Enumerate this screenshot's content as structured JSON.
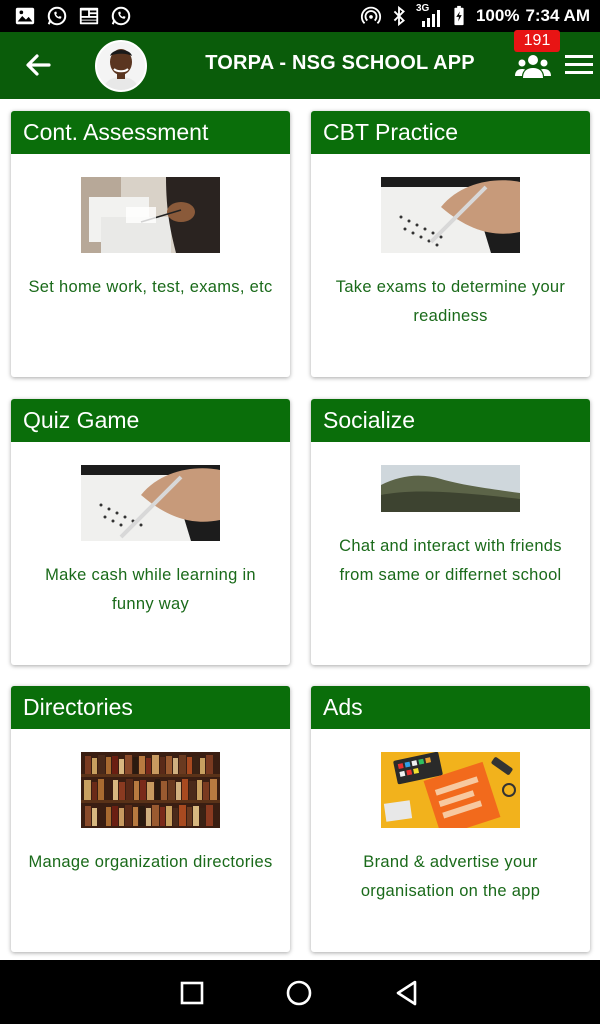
{
  "status_bar": {
    "network": "3G",
    "battery": "100%",
    "time": "7:34 AM"
  },
  "app_bar": {
    "title": "TORPA - NSG SCHOOL APP",
    "notification_count": "191"
  },
  "cards": [
    {
      "title": "Cont. Assessment",
      "description": "Set home work, test, exams, etc"
    },
    {
      "title": "CBT Practice",
      "description": "Take exams to determine your readiness"
    },
    {
      "title": "Quiz Game",
      "description": "Make cash while learning in funny way"
    },
    {
      "title": "Socialize",
      "description": "Chat and interact with friends from same or differnet school"
    },
    {
      "title": "Directories",
      "description": "Manage organization directories"
    },
    {
      "title": "Ads",
      "description": "Brand & advertise your organisation on the app"
    }
  ],
  "card_images": [
    {
      "alt": "Cont. Assessment"
    },
    {
      "alt": "CBT Practice"
    },
    {
      "alt": "Quiz Game"
    },
    {
      "alt": "Socialize"
    },
    {
      "alt": "Directories"
    },
    {
      "alt": "Ads"
    }
  ],
  "colors": {
    "app_bar": "#0a5c0a",
    "card_header": "#0a6e0a",
    "description_text": "#1a6a1a",
    "badge": "#e81414"
  },
  "icons": {
    "back": "arrow-left-icon",
    "users": "users-group-icon",
    "menu": "hamburger-menu-icon",
    "nav_recents": "square-icon",
    "nav_home": "circle-icon",
    "nav_back": "triangle-back-icon"
  }
}
